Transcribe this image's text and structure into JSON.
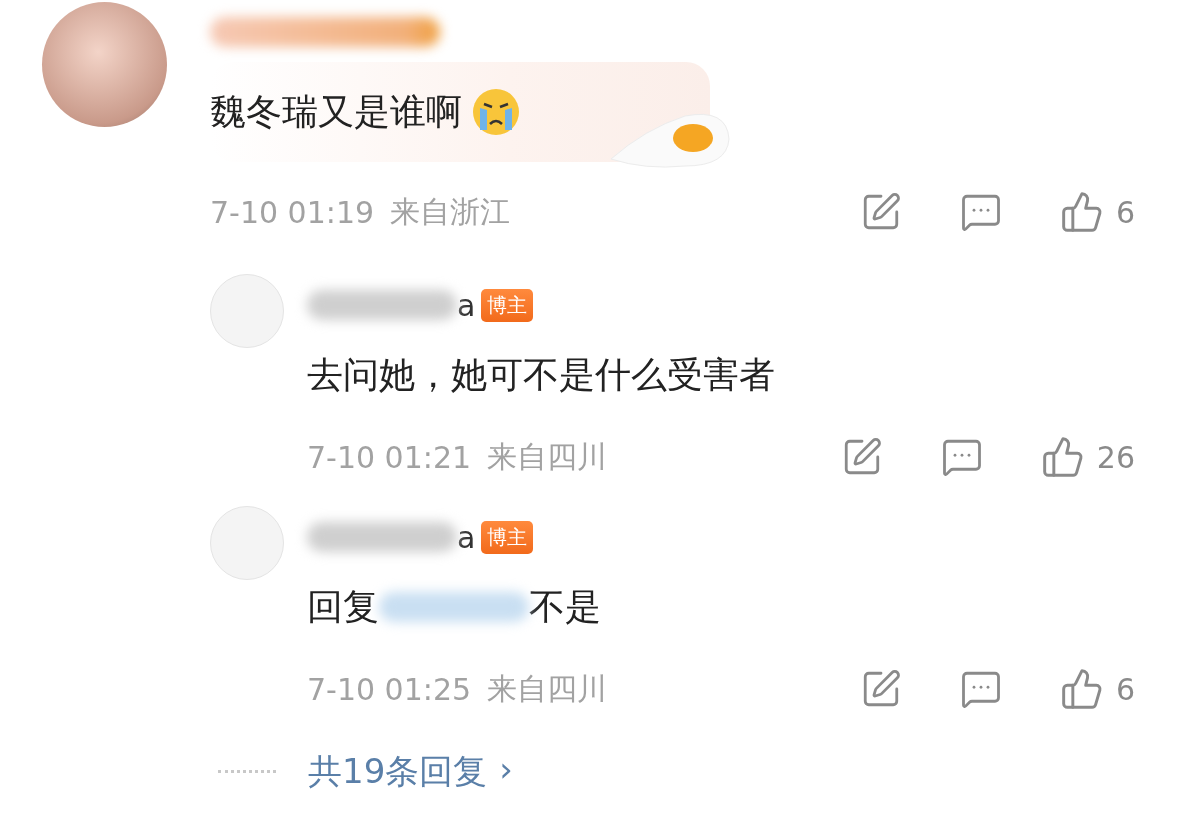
{
  "comment": {
    "text": "魏冬瑞又是谁啊",
    "time": "7-10 01:19",
    "location": "来自浙江",
    "likes": "6",
    "replies": [
      {
        "name_tail": "a",
        "badge": "博主",
        "text": "去问她，她可不是什么受害者",
        "time": "7-10 01:21",
        "location": "来自四川",
        "likes": "26"
      },
      {
        "name_tail": "a",
        "badge": "博主",
        "reply_prefix": "回复",
        "text": "不是",
        "time": "7-10 01:25",
        "location": "来自四川",
        "likes": "6"
      }
    ],
    "reply_count": "共19条回复",
    "more_arrow": "›"
  }
}
